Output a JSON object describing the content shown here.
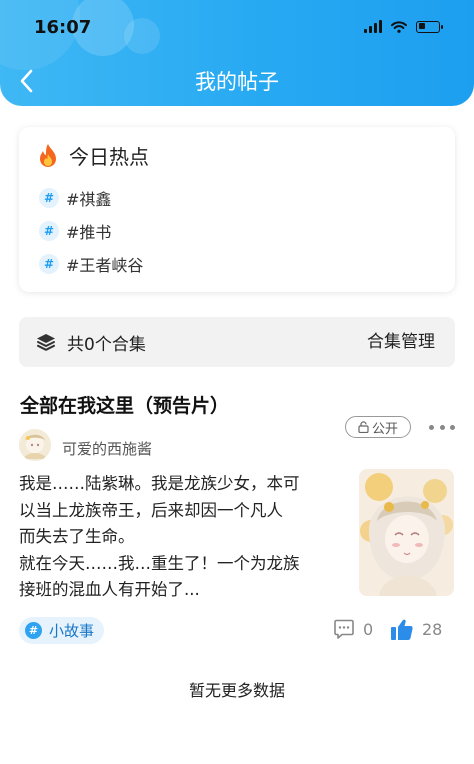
{
  "status_bar": {
    "time": "16:07",
    "battery_level": 0.35
  },
  "header": {
    "title": "我的帖子"
  },
  "hot_topics": {
    "title": "今日热点",
    "icon": "flame-icon",
    "tags": [
      "#祺鑫",
      "#推书",
      "#王者峡谷"
    ]
  },
  "collections": {
    "count_label": "共0个合集",
    "manage_label": "合集管理"
  },
  "post": {
    "title": "全部在我这里（预告片）",
    "author": "可爱的西施酱",
    "visibility_label": "公开",
    "body_lines": [
      "我是……陆紫琳。我是龙族少女，本可",
      "以当上龙族帝王，后来却因一个凡人",
      "而失去了生命。",
      "就在今天……我…重生了！一个为龙族",
      "接班的混血人有开始了..."
    ],
    "topic": "小故事",
    "comment_count": "0",
    "like_count": "28"
  },
  "footer": {
    "no_more_text": "暂无更多数据"
  },
  "colors": {
    "accent": "#1e9ef2",
    "header_start": "#3fb8f4",
    "header_end": "#1d9ff0",
    "flame": "#f5671f"
  }
}
